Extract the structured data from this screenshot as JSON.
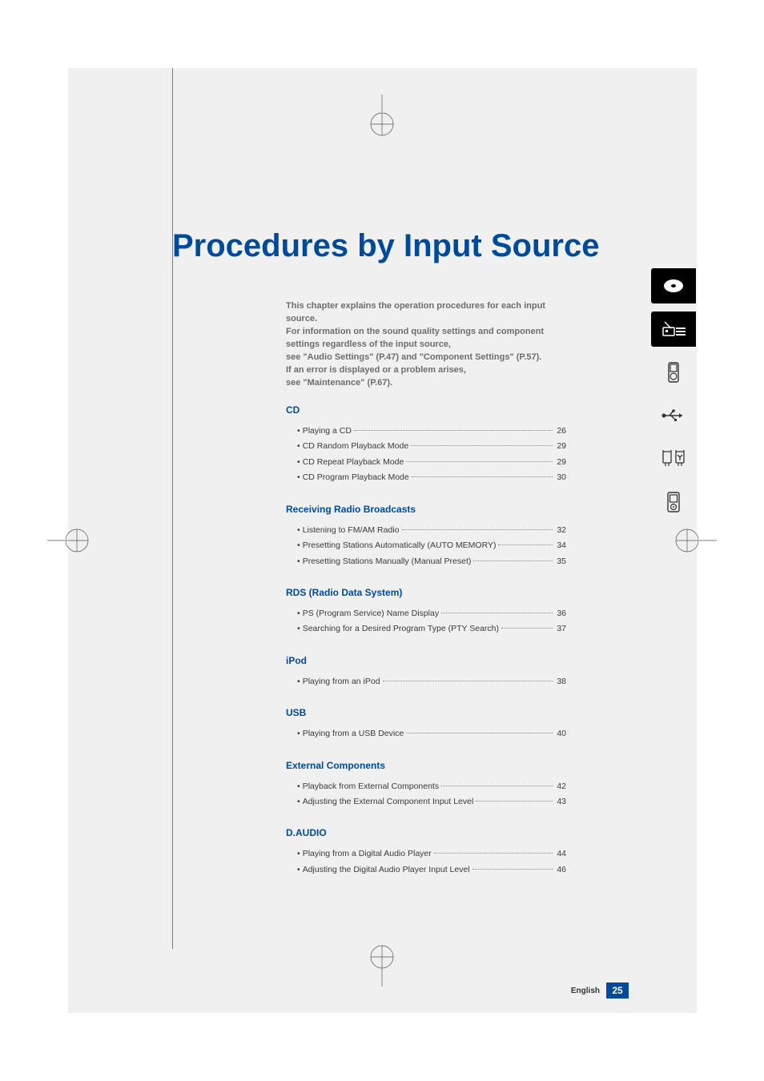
{
  "title": "Procedures by Input Source",
  "intro": {
    "l1": "This chapter explains the operation procedures for each input source.",
    "l2": "For information on the sound quality settings and component settings regardless of the input source,",
    "l3": "see \"Audio Settings\" (P.47) and \"Component Settings\" (P.57).",
    "l4": "If an error is displayed or a problem arises,",
    "l5": "see \"Maintenance\" (P.67)."
  },
  "sections": {
    "cd": {
      "head": "CD",
      "items": [
        {
          "label": "Playing a CD",
          "page": "26"
        },
        {
          "label": "CD Random Playback Mode",
          "page": "29"
        },
        {
          "label": "CD Repeat Playback Mode",
          "page": "29"
        },
        {
          "label": "CD Program Playback Mode",
          "page": "30"
        }
      ]
    },
    "radio": {
      "head": "Receiving Radio Broadcasts",
      "items": [
        {
          "label": "Listening to FM/AM Radio",
          "page": "32"
        },
        {
          "label": "Presetting Stations Automatically (AUTO MEMORY)",
          "page": "34"
        },
        {
          "label": "Presetting Stations Manually (Manual Preset)",
          "page": "35"
        }
      ]
    },
    "rds": {
      "head": "RDS (Radio Data System)",
      "items": [
        {
          "label": "PS (Program Service) Name Display",
          "page": "36"
        },
        {
          "label": "Searching for a Desired Program Type (PTY Search)",
          "page": "37"
        }
      ]
    },
    "ipod": {
      "head": "iPod",
      "items": [
        {
          "label": "Playing from an iPod",
          "page": "38"
        }
      ]
    },
    "usb": {
      "head": "USB",
      "items": [
        {
          "label": "Playing from a USB Device",
          "page": "40"
        }
      ]
    },
    "ext": {
      "head": "External Components",
      "items": [
        {
          "label": "Playback from External Components",
          "page": "42"
        },
        {
          "label": "Adjusting the External Component Input Level",
          "page": "43"
        }
      ]
    },
    "daudio": {
      "head": "D.AUDIO",
      "items": [
        {
          "label": "Playing from a Digital Audio Player",
          "page": "44"
        },
        {
          "label": "Adjusting the Digital Audio Player Input Level",
          "page": "46"
        }
      ]
    }
  },
  "footer": {
    "lang": "English",
    "page": "25"
  },
  "tabs": [
    {
      "name": "cd-tab-icon",
      "selected": true
    },
    {
      "name": "radio-tab-icon",
      "selected": true
    },
    {
      "name": "ipod-tab-icon",
      "selected": false
    },
    {
      "name": "usb-tab-icon",
      "selected": false
    },
    {
      "name": "external-tab-icon",
      "selected": false
    },
    {
      "name": "daudio-tab-icon",
      "selected": false
    }
  ]
}
